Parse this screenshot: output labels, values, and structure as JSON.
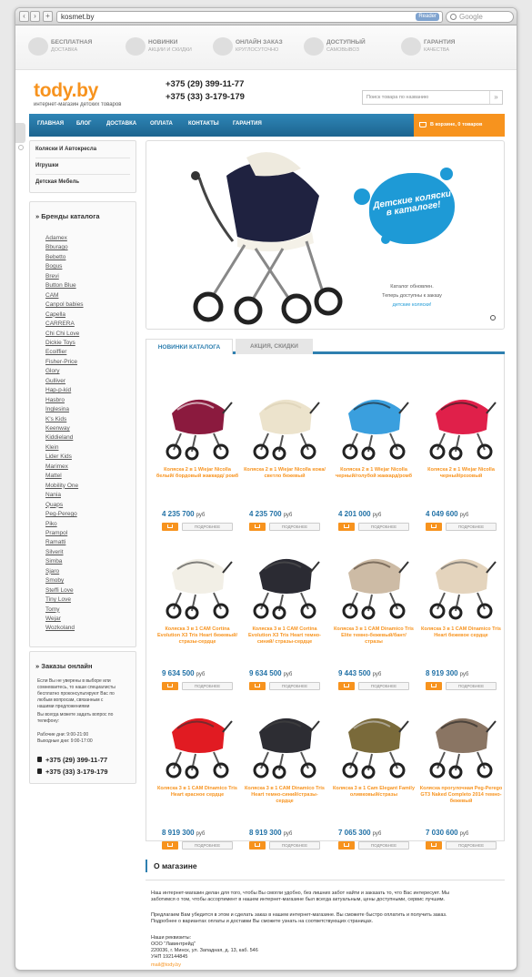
{
  "browser": {
    "address": "kosmet.by",
    "reader_label": "Reader",
    "search_placeholder": "Google"
  },
  "features": [
    {
      "title": "БЕСПЛАТНАЯ",
      "subtitle": "ДОСТАВКА",
      "icon": "truck-icon"
    },
    {
      "title": "НОВИНКИ",
      "subtitle": "АКЦИИ И СКИДКИ",
      "icon": "discount-icon"
    },
    {
      "title": "ОНЛАЙН ЗАКАЗ",
      "subtitle": "КРУГЛОСУТОЧНО",
      "icon": "card-icon"
    },
    {
      "title": "ДОСТУПНЫЙ",
      "subtitle": "САМОВЫВОЗ",
      "icon": "box-icon"
    },
    {
      "title": "ГАРАНТИЯ",
      "subtitle": "КАЧЕСТВА",
      "icon": "check-icon"
    }
  ],
  "header": {
    "logo": "tody.by",
    "tagline": "интернет-магазин детских товаров",
    "phone1": "+375 (29) 399-11-77",
    "phone2": "+375 (33) 3-179-179",
    "search_placeholder": "Поиск товара по названию"
  },
  "menu": [
    "ГЛАВНАЯ",
    "БЛОГ",
    "ДОСТАВКА",
    "ОПЛАТА",
    "КОНТАКТЫ",
    "ГАРАНТИЯ"
  ],
  "cart": {
    "label": "В корзине, 0 товаров"
  },
  "categories": [
    "Коляски И Автокресла",
    "Игрушки",
    "Детская Мебель"
  ],
  "brands": {
    "title": "Бренды каталога",
    "items": [
      "Adamex",
      "Bburago",
      "Bebetto",
      "Bogus",
      "Brevi",
      "Button Blue",
      "CAM",
      "Canpol babies",
      "Capella",
      "CARRERA",
      "Chi Chi Love",
      "Dickie Toys",
      "Ecoiffier",
      "Fisher-Price",
      "Glory",
      "Gulliver",
      "Hap-p-kid",
      "Hasbro",
      "Inglesina",
      "K's Kids",
      "Keenway",
      "Kiddieland",
      "Klein",
      "Lider Kids",
      "Marimex",
      "Mattel",
      "Mobility One",
      "Nania",
      "Quaps",
      "Peg-Perego",
      "Piko",
      "Prampol",
      "Ramatti",
      "Silverit",
      "Simba",
      "Sjaro",
      "Smoby",
      "Steffi Love",
      "Tiny Love",
      "Tomy",
      "Wejar",
      "Wozkoland"
    ]
  },
  "orders": {
    "title": "Заказы онлайн",
    "lines": [
      "Если Вы не уверены в выборе или",
      "сомневаетесь, то наши специалисты",
      "бесплатно проконсультируют Вас по",
      "любым вопросам, связанным с",
      "нашими предложениями",
      "Вы всегда можете задать вопрос по",
      "телефону:",
      "Рабочие дни: 9:00-21:00",
      "Выходные дни: 9:00-17:00"
    ],
    "phone1": "+375 (29) 399-11-77",
    "phone2": "+375 (33) 3-179-179"
  },
  "banner": {
    "headline": "Детские коляски в каталоге!",
    "caption1": "Каталог обновлен.",
    "caption2": "Теперь доступны к заказу",
    "caption_link": "детские коляски!"
  },
  "tabs": [
    "НОВИНКИ КАТАЛОГА",
    "АКЦИЯ, СКИДКИ"
  ],
  "currency": "руб",
  "details_label": "ПОДРОБНЕЕ",
  "products": [
    {
      "name": "Коляска 2 в 1 Wiejar Nicolla белый/ бордовый жаккард/ ромб",
      "price": "4 235 700",
      "color": "#8b1a3e",
      "accent": "#ffffff"
    },
    {
      "name": "Коляска 2 в 1 Wiejar Nicolla кожа/светло бежевый",
      "price": "4 235 700",
      "color": "#ece3cc",
      "accent": "#d8cdb0"
    },
    {
      "name": "Коляска 2 в 1 Wiejar Nicolla черный/голубой жаккард/ромб",
      "price": "4 201 000",
      "color": "#3a9fde",
      "accent": "#1f1f1f"
    },
    {
      "name": "Коляска 2 в 1 Wiejar Nicolla черный/розовый",
      "price": "4 049 600",
      "color": "#e0204a",
      "accent": "#1f1f1f"
    },
    {
      "name": "Коляска 3 в 1 CAM Cortina Evolution X3 Tris Heart бежевый/стразы-сердце",
      "price": "9 634 500",
      "color": "#f2efe6",
      "accent": "#333333"
    },
    {
      "name": "Коляска 3 в 1 CAM Cortina Evolution X3 Tris Heart темно-синий/ стразы-сердце",
      "price": "9 634 500",
      "color": "#2b2b33",
      "accent": "#555555"
    },
    {
      "name": "Коляска 3 в 1 CAM Dinamico Tris Elite темно-бежевый/бант/ стразы",
      "price": "9 443 500",
      "color": "#cdbba5",
      "accent": "#4a3c30"
    },
    {
      "name": "Коляска 3 в 1 CAM Dinamico Tris Heart бежевое сердце",
      "price": "8 919 300",
      "color": "#e4d4bd",
      "accent": "#555555"
    },
    {
      "name": "Коляска 3 в 1 CAM Dinamico Tris Heart красное сердце",
      "price": "8 919 300",
      "color": "#e11b22",
      "accent": "#333333"
    },
    {
      "name": "Коляска 3 в 1 CAM Dinamico Tris Heart темно-синий/стразы-сердце",
      "price": "8 919 300",
      "color": "#2d2d33",
      "accent": "#444444"
    },
    {
      "name": "Коляска 3 в 1 Cam Elegant Family оливковый/стразы",
      "price": "7 065 300",
      "color": "#7a6a3a",
      "accent": "#c9c9c9"
    },
    {
      "name": "Коляска прогулочная Peg-Perego GT3 Naked Completo 2014 темно-бежевый",
      "price": "7 030 600",
      "color": "#8a7563",
      "accent": "#222222"
    }
  ],
  "about": {
    "title": "О магазине",
    "lines": [
      "Наш интернет-магазин делан для того, чтобы Вы смогли удобно, без лишних забот найти и заказать то, что Вас интересует. Мы",
      "заботимся о том, чтобы ассортимент в нашем интернет-магазине был всегда актуальным, цены доступными, сервис лучшим.",
      "Предлагаем Вам убедится в этом и сделать заказ в нашем интернет-магазине. Вы сможете быстро оплатить и получить заказ.",
      "Подробнее о вариантах оплаты и доставки Вы сможете узнать на соответствующих страницах.",
      "Наши реквизиты:",
      "ООО \"Лавинтрейд\"",
      "220036, г. Минск, ул. Западная, д. 13, каб. 546",
      "УНП 192144845"
    ],
    "email": "mail@tody.by"
  },
  "colors": {
    "accent": "#f7931e",
    "menu": "#1c648f",
    "link": "#2171a6",
    "banner_blob": "#1e9ad6"
  }
}
